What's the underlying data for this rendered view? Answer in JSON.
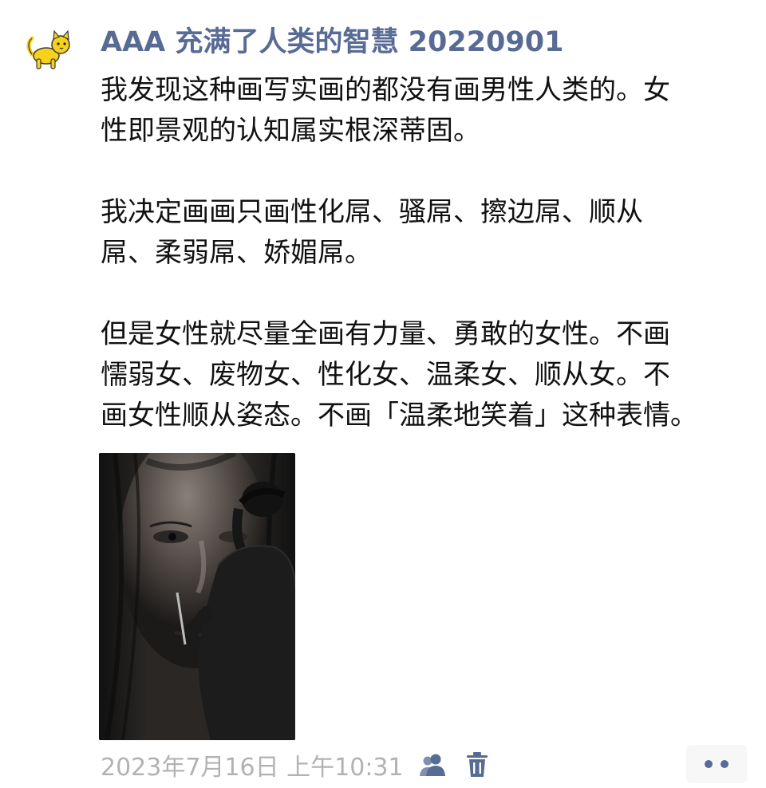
{
  "post": {
    "author": "AAA 充满了人类的智慧 20220901",
    "paragraphs": [
      {
        "lines": [
          "我发现这种画写实画的都没有画男性人类的。女",
          "性即景观的认知属实根深蒂固。"
        ]
      },
      {
        "lines": [
          "我决定画画只画性化屌、骚屌、擦边屌、顺从",
          "屌、柔弱屌、娇媚屌。"
        ]
      },
      {
        "lines": [
          "但是女性就尽量全画有力量、勇敢的女性。不画",
          "懦弱女、废物女、性化女、温柔女、顺从女。不",
          "画女性顺从姿态。不画「温柔地笑着」这种表情。"
        ]
      }
    ],
    "timestamp": "2023年7月16日 上午10:31"
  },
  "icons": {
    "avatar": "yellow-cat-icon",
    "visibility": "friends-icon",
    "delete": "trash-icon",
    "more": "more-dots-icon"
  },
  "colors": {
    "author_link": "#576b95",
    "body_text": "#111111",
    "timestamp": "#b2b2b2",
    "footer_icon": "#576b95",
    "avatar_cat": "#f7d21b"
  }
}
